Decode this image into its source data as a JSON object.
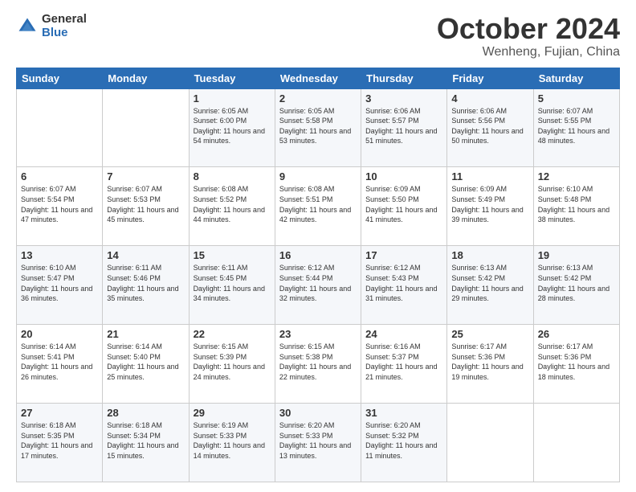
{
  "header": {
    "logo_general": "General",
    "logo_blue": "Blue",
    "month_title": "October 2024",
    "location": "Wenheng, Fujian, China"
  },
  "weekdays": [
    "Sunday",
    "Monday",
    "Tuesday",
    "Wednesday",
    "Thursday",
    "Friday",
    "Saturday"
  ],
  "weeks": [
    [
      {
        "day": "",
        "sunrise": "",
        "sunset": "",
        "daylight": ""
      },
      {
        "day": "",
        "sunrise": "",
        "sunset": "",
        "daylight": ""
      },
      {
        "day": "1",
        "sunrise": "Sunrise: 6:05 AM",
        "sunset": "Sunset: 6:00 PM",
        "daylight": "Daylight: 11 hours and 54 minutes."
      },
      {
        "day": "2",
        "sunrise": "Sunrise: 6:05 AM",
        "sunset": "Sunset: 5:58 PM",
        "daylight": "Daylight: 11 hours and 53 minutes."
      },
      {
        "day": "3",
        "sunrise": "Sunrise: 6:06 AM",
        "sunset": "Sunset: 5:57 PM",
        "daylight": "Daylight: 11 hours and 51 minutes."
      },
      {
        "day": "4",
        "sunrise": "Sunrise: 6:06 AM",
        "sunset": "Sunset: 5:56 PM",
        "daylight": "Daylight: 11 hours and 50 minutes."
      },
      {
        "day": "5",
        "sunrise": "Sunrise: 6:07 AM",
        "sunset": "Sunset: 5:55 PM",
        "daylight": "Daylight: 11 hours and 48 minutes."
      }
    ],
    [
      {
        "day": "6",
        "sunrise": "Sunrise: 6:07 AM",
        "sunset": "Sunset: 5:54 PM",
        "daylight": "Daylight: 11 hours and 47 minutes."
      },
      {
        "day": "7",
        "sunrise": "Sunrise: 6:07 AM",
        "sunset": "Sunset: 5:53 PM",
        "daylight": "Daylight: 11 hours and 45 minutes."
      },
      {
        "day": "8",
        "sunrise": "Sunrise: 6:08 AM",
        "sunset": "Sunset: 5:52 PM",
        "daylight": "Daylight: 11 hours and 44 minutes."
      },
      {
        "day": "9",
        "sunrise": "Sunrise: 6:08 AM",
        "sunset": "Sunset: 5:51 PM",
        "daylight": "Daylight: 11 hours and 42 minutes."
      },
      {
        "day": "10",
        "sunrise": "Sunrise: 6:09 AM",
        "sunset": "Sunset: 5:50 PM",
        "daylight": "Daylight: 11 hours and 41 minutes."
      },
      {
        "day": "11",
        "sunrise": "Sunrise: 6:09 AM",
        "sunset": "Sunset: 5:49 PM",
        "daylight": "Daylight: 11 hours and 39 minutes."
      },
      {
        "day": "12",
        "sunrise": "Sunrise: 6:10 AM",
        "sunset": "Sunset: 5:48 PM",
        "daylight": "Daylight: 11 hours and 38 minutes."
      }
    ],
    [
      {
        "day": "13",
        "sunrise": "Sunrise: 6:10 AM",
        "sunset": "Sunset: 5:47 PM",
        "daylight": "Daylight: 11 hours and 36 minutes."
      },
      {
        "day": "14",
        "sunrise": "Sunrise: 6:11 AM",
        "sunset": "Sunset: 5:46 PM",
        "daylight": "Daylight: 11 hours and 35 minutes."
      },
      {
        "day": "15",
        "sunrise": "Sunrise: 6:11 AM",
        "sunset": "Sunset: 5:45 PM",
        "daylight": "Daylight: 11 hours and 34 minutes."
      },
      {
        "day": "16",
        "sunrise": "Sunrise: 6:12 AM",
        "sunset": "Sunset: 5:44 PM",
        "daylight": "Daylight: 11 hours and 32 minutes."
      },
      {
        "day": "17",
        "sunrise": "Sunrise: 6:12 AM",
        "sunset": "Sunset: 5:43 PM",
        "daylight": "Daylight: 11 hours and 31 minutes."
      },
      {
        "day": "18",
        "sunrise": "Sunrise: 6:13 AM",
        "sunset": "Sunset: 5:42 PM",
        "daylight": "Daylight: 11 hours and 29 minutes."
      },
      {
        "day": "19",
        "sunrise": "Sunrise: 6:13 AM",
        "sunset": "Sunset: 5:42 PM",
        "daylight": "Daylight: 11 hours and 28 minutes."
      }
    ],
    [
      {
        "day": "20",
        "sunrise": "Sunrise: 6:14 AM",
        "sunset": "Sunset: 5:41 PM",
        "daylight": "Daylight: 11 hours and 26 minutes."
      },
      {
        "day": "21",
        "sunrise": "Sunrise: 6:14 AM",
        "sunset": "Sunset: 5:40 PM",
        "daylight": "Daylight: 11 hours and 25 minutes."
      },
      {
        "day": "22",
        "sunrise": "Sunrise: 6:15 AM",
        "sunset": "Sunset: 5:39 PM",
        "daylight": "Daylight: 11 hours and 24 minutes."
      },
      {
        "day": "23",
        "sunrise": "Sunrise: 6:15 AM",
        "sunset": "Sunset: 5:38 PM",
        "daylight": "Daylight: 11 hours and 22 minutes."
      },
      {
        "day": "24",
        "sunrise": "Sunrise: 6:16 AM",
        "sunset": "Sunset: 5:37 PM",
        "daylight": "Daylight: 11 hours and 21 minutes."
      },
      {
        "day": "25",
        "sunrise": "Sunrise: 6:17 AM",
        "sunset": "Sunset: 5:36 PM",
        "daylight": "Daylight: 11 hours and 19 minutes."
      },
      {
        "day": "26",
        "sunrise": "Sunrise: 6:17 AM",
        "sunset": "Sunset: 5:36 PM",
        "daylight": "Daylight: 11 hours and 18 minutes."
      }
    ],
    [
      {
        "day": "27",
        "sunrise": "Sunrise: 6:18 AM",
        "sunset": "Sunset: 5:35 PM",
        "daylight": "Daylight: 11 hours and 17 minutes."
      },
      {
        "day": "28",
        "sunrise": "Sunrise: 6:18 AM",
        "sunset": "Sunset: 5:34 PM",
        "daylight": "Daylight: 11 hours and 15 minutes."
      },
      {
        "day": "29",
        "sunrise": "Sunrise: 6:19 AM",
        "sunset": "Sunset: 5:33 PM",
        "daylight": "Daylight: 11 hours and 14 minutes."
      },
      {
        "day": "30",
        "sunrise": "Sunrise: 6:20 AM",
        "sunset": "Sunset: 5:33 PM",
        "daylight": "Daylight: 11 hours and 13 minutes."
      },
      {
        "day": "31",
        "sunrise": "Sunrise: 6:20 AM",
        "sunset": "Sunset: 5:32 PM",
        "daylight": "Daylight: 11 hours and 11 minutes."
      },
      {
        "day": "",
        "sunrise": "",
        "sunset": "",
        "daylight": ""
      },
      {
        "day": "",
        "sunrise": "",
        "sunset": "",
        "daylight": ""
      }
    ]
  ]
}
